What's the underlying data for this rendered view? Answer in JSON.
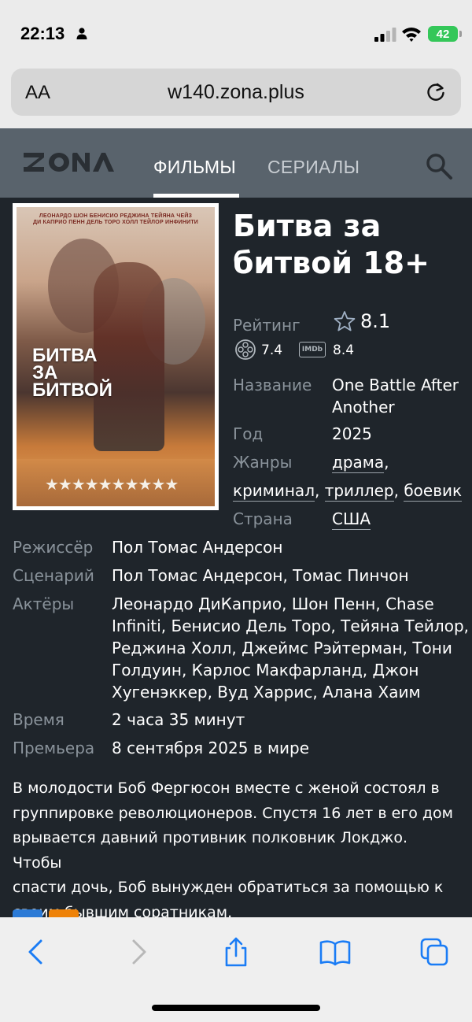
{
  "status_bar": {
    "time": "22:13",
    "battery": "42"
  },
  "browser": {
    "aa_label": "AA",
    "url": "w140.zona.plus"
  },
  "site": {
    "nav": {
      "films": "ФИЛЬМЫ",
      "series": "СЕРИАЛЫ"
    }
  },
  "poster": {
    "credits_line1": "ЛЕОНАРДО ШОН БЕНИСИО РЕДЖИНА ТЕЙЯНА ЧЕЙЗ",
    "credits_line2": "ДИ КАПРИО ПЕНН ДЕЛЬ ТОРО ХОЛЛ ТЕЙЛОР ИНФИНИТИ",
    "title": "БИТВА\nЗА\nБИТВОЙ",
    "stars": "★★★★★★★★★★"
  },
  "movie": {
    "title": "Битва за битвой 18+",
    "rating_label": "Рейтинг",
    "rating": "8.1",
    "kp_rating": "7.4",
    "imdb_label": "IMDb",
    "imdb_rating": "8.4",
    "name_label": "Название",
    "original_title_line1": "One Battle After",
    "original_title_line2": "Another",
    "year_label": "Год",
    "year": "2025",
    "genres_label": "Жанры",
    "genres": [
      "драма",
      "криминал",
      "триллер",
      "боевик"
    ],
    "country_label": "Страна",
    "country": "США",
    "director_label": "Режиссёр",
    "director": "Пол Томас Андерсон",
    "writer_label": "Сценарий",
    "writers": "Пол Томас Андерсон, Томас Пинчон",
    "actors_label": "Актёры",
    "actors_lines": [
      "Леонардо ДиКаприо, Шон Пенн, Chase",
      "Infiniti, Бенисио Дель Торо, Тейяна Тейлор,",
      "Реджина Холл, Джеймс Рэйтерман, Тони",
      "Голдуин, Карлос Макфарланд, Джон",
      "Хугенэккер, Вуд Харрис, Алана Хаим"
    ],
    "duration_label": "Время",
    "duration": "2 часа 35 минут",
    "premiere_label": "Премьера",
    "premiere": "8 сентября 2025 в мире",
    "description_lines": [
      "В молодости Боб Фергюсон вместе с женой состоял в",
      "группировке революционеров. Спустя 16 лет в его дом",
      "врывается давний противник полковник Локджо. Чтобы",
      "спасти дочь, Боб вынужден обратиться за помощью к",
      "своим бывшим соратникам."
    ]
  },
  "colors": {
    "page_bg": "#1f252b",
    "header_bg": "#59636c",
    "label": "#8a939b",
    "ios_blue": "#1a7cf5"
  }
}
